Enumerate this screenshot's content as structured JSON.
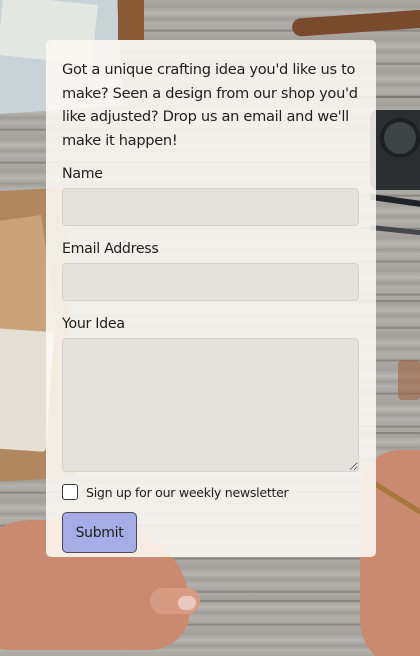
{
  "form": {
    "intro": "Got a unique crafting idea you'd like us to make? Seen a design from our shop you'd like adjusted? Drop us an email and we'll make it happen!",
    "name_label": "Name",
    "name_value": "",
    "email_label": "Email Address",
    "email_value": "",
    "idea_label": "Your Idea",
    "idea_value": "",
    "newsletter_label": "Sign up for our weekly newsletter",
    "newsletter_checked": false,
    "submit_label": "Submit"
  },
  "colors": {
    "card_background": "#fcf9f4",
    "field_background": "#e0ded9",
    "submit_background": "#a5ace6",
    "text": "#1f1f1f"
  }
}
